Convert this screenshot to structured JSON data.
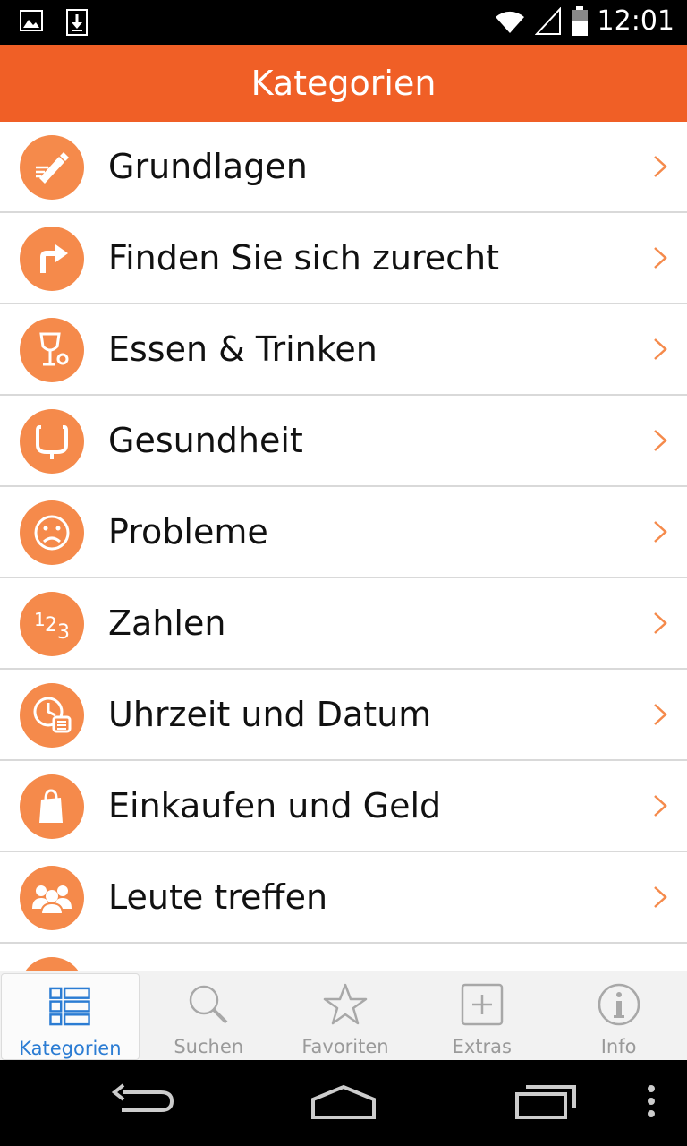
{
  "status_bar": {
    "time": "12:01"
  },
  "header": {
    "title": "Kategorien"
  },
  "categories": [
    {
      "label": "Grundlagen",
      "icon": "pencil-icon"
    },
    {
      "label": "Finden Sie sich zurecht",
      "icon": "turn-right-arrow-icon"
    },
    {
      "label": "Essen & Trinken",
      "icon": "wine-glass-icon"
    },
    {
      "label": "Gesundheit",
      "icon": "stethoscope-icon"
    },
    {
      "label": "Probleme",
      "icon": "sad-face-icon"
    },
    {
      "label": "Zahlen",
      "icon": "numbers-123-icon"
    },
    {
      "label": "Uhrzeit und Datum",
      "icon": "clock-calendar-icon"
    },
    {
      "label": "Einkaufen und Geld",
      "icon": "shopping-bag-icon"
    },
    {
      "label": "Leute treffen",
      "icon": "people-icon"
    }
  ],
  "tabs": [
    {
      "label": "Kategorien",
      "icon": "grid-list-icon",
      "active": true
    },
    {
      "label": "Suchen",
      "icon": "search-icon",
      "active": false
    },
    {
      "label": "Favoriten",
      "icon": "star-icon",
      "active": false
    },
    {
      "label": "Extras",
      "icon": "plus-box-icon",
      "active": false
    },
    {
      "label": "Info",
      "icon": "info-icon",
      "active": false
    }
  ],
  "colors": {
    "accent": "#f05f26",
    "icon_bg": "#f58a4b",
    "active_tab": "#2b7cd3",
    "inactive_tab": "#9a9a9a"
  }
}
